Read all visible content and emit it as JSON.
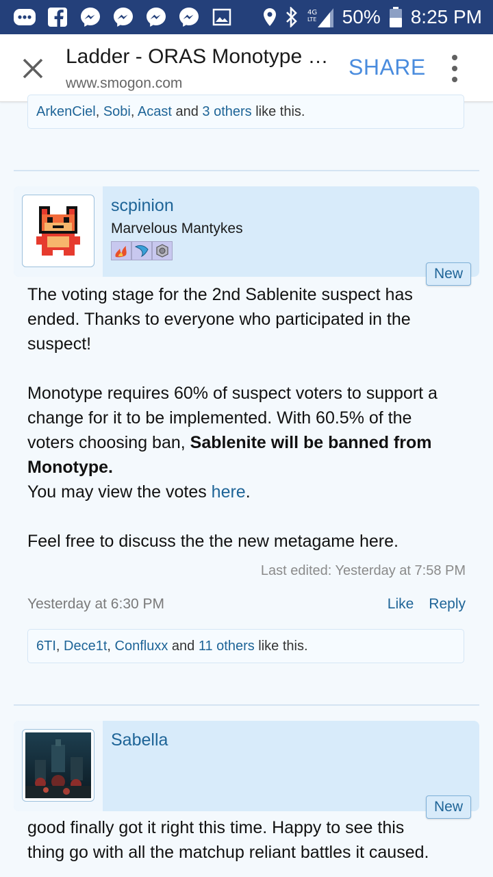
{
  "status_bar": {
    "battery": "50%",
    "time": "8:25 PM",
    "network": "4G LTE",
    "notification_icons": [
      "more-icon",
      "facebook-icon",
      "messenger-icon",
      "messenger-icon",
      "messenger-icon",
      "messenger-icon",
      "image-icon"
    ]
  },
  "browser": {
    "title": "Ladder - ORAS Monotype Metagame Discussion",
    "url": "www.smogon.com",
    "share_label": "SHARE"
  },
  "prev_post": {
    "likes": {
      "users": [
        "ArkenCiel",
        "Sobi",
        "Acast"
      ],
      "others": "3 others",
      "suffix": " like this.",
      "and": " and "
    }
  },
  "post1": {
    "username": "scpinion",
    "user_title": "Marvelous Mantykes",
    "badge_icons": [
      "fire-badge-icon",
      "water-badge-icon",
      "steel-badge-icon"
    ],
    "new_label": "New",
    "paragraph1": "The voting stage for the 2nd Sablenite suspect has ended. Thanks to everyone who participated in the suspect!",
    "paragraph2_normal": "Monotype requires 60% of suspect voters to support a change for it to be implemented. With 60.5% of the voters choosing ban, ",
    "paragraph2_bold": "Sablenite will be banned from Monotype.",
    "votes_prefix": "You may view the votes ",
    "votes_link": "here",
    "votes_suffix": ".",
    "paragraph3": "Feel free to discuss the the new metagame here.",
    "last_edited": "Last edited: Yesterday at 7:58 PM",
    "timestamp": "Yesterday at 6:30 PM",
    "like_label": "Like",
    "reply_label": "Reply",
    "likes": {
      "users": [
        "6TI",
        "Dece1t",
        "Confluxx"
      ],
      "others": "11 others",
      "suffix": " like this.",
      "and": " and "
    }
  },
  "post2": {
    "username": "Sabella",
    "new_label": "New",
    "text": "good finally got it right this time. Happy to see this thing go with all the matchup reliant battles it caused."
  },
  "colors": {
    "status_bar": "#24407a",
    "link": "#1e6497",
    "share": "#4a8cde",
    "userblock": "#d8ebfa"
  }
}
